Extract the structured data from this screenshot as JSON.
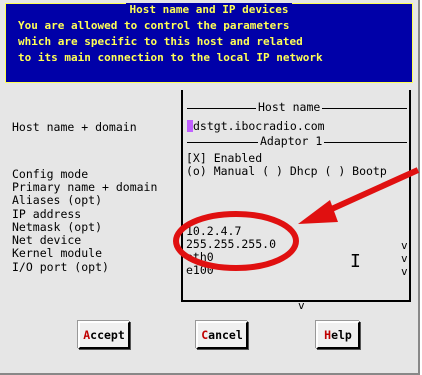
{
  "panel": {
    "title": "Host name and IP devices",
    "info_lines": [
      "You are allowed to control the parameters",
      "which are specific to this host and related",
      "to its main connection to the local IP network"
    ]
  },
  "labels": {
    "host": "Host name + domain",
    "config": "Config mode",
    "primary": "Primary name + domain",
    "aliases": "Aliases (opt)",
    "ip": "IP address",
    "netmask": "Netmask (opt)",
    "netdev": "Net device",
    "kernel": "Kernel module",
    "ioport": "I/O port (opt)"
  },
  "form": {
    "host_section": "Host name",
    "host_value": "dstgt.ibocradio.com",
    "adaptor_section": "Adaptor 1",
    "enabled": "[X] Enabled",
    "config_mode": "(o) Manual ( ) Dhcp ( ) Bootp",
    "ip_value": "10.2.4.7",
    "netmask_value": "255.255.255.0",
    "netdev_value": "eth0",
    "kernel_value": "e100",
    "dropdown_mark": "v",
    "scroll_mark": "v"
  },
  "buttons": {
    "accept_hot": "A",
    "accept_rest": "ccept",
    "cancel_hot": "C",
    "cancel_rest": "ancel",
    "help_hot": "H",
    "help_rest": "elp"
  },
  "annotation": {
    "color": "#e01010"
  },
  "colors": {
    "panel_bg": "#0000a8",
    "panel_text": "#ffff55",
    "dialog_bg": "#e6e6e6"
  }
}
